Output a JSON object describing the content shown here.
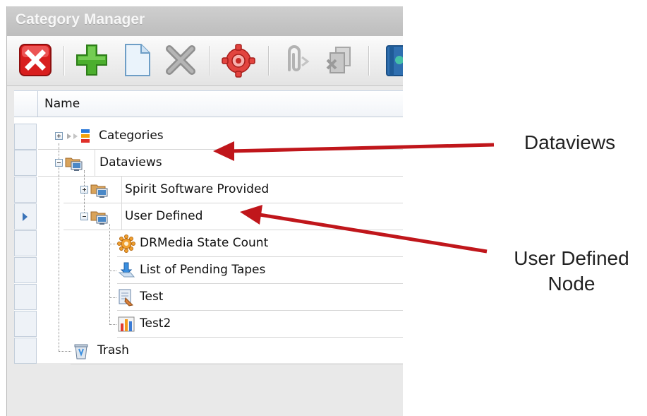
{
  "window": {
    "title": "Category Manager"
  },
  "toolbar": {
    "buttons": [
      {
        "icon": "close-icon"
      },
      {
        "icon": "add-icon"
      },
      {
        "icon": "new-document-icon"
      },
      {
        "icon": "delete-icon"
      },
      {
        "icon": "gear-icon"
      },
      {
        "icon": "attach-icon"
      },
      {
        "icon": "move-icon"
      },
      {
        "icon": "book-icon"
      }
    ]
  },
  "grid": {
    "column_header": "Name",
    "rows": [
      {
        "label": "Categories",
        "icon": "categories-icon",
        "expander": "+"
      },
      {
        "label": "Dataviews",
        "icon": "dataviews-folder-icon",
        "expander": "-"
      },
      {
        "label": "Spirit Software Provided",
        "icon": "dataviews-folder-icon",
        "expander": "+"
      },
      {
        "label": "User Defined",
        "icon": "dataviews-folder-icon",
        "expander": "-",
        "current": true
      },
      {
        "label": "DRMedia State Count",
        "icon": "gear-sun-icon"
      },
      {
        "label": "List of Pending Tapes",
        "icon": "tape-icon"
      },
      {
        "label": "Test",
        "icon": "report-icon"
      },
      {
        "label": "Test2",
        "icon": "bar-chart-icon"
      },
      {
        "label": "Trash",
        "icon": "trash-icon"
      }
    ]
  },
  "annotations": {
    "dataviews": "Dataviews",
    "user_defined_line1": "User Defined",
    "user_defined_line2": "Node",
    "arrow_color": "#c0161b"
  }
}
